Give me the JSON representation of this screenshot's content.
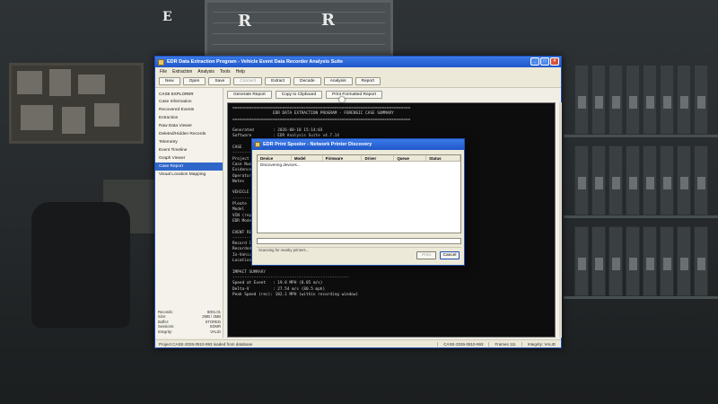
{
  "hud": {
    "letters": [
      "E",
      "R",
      "R"
    ]
  },
  "window": {
    "title": "EDR Data Extraction Program - Vehicle Event Data Recorder Analysis Suite",
    "menu": [
      "File",
      "Extraction",
      "Analysis",
      "Tools",
      "Help"
    ],
    "toolbar": [
      {
        "label": "New",
        "enabled": true
      },
      {
        "label": "Open",
        "enabled": true
      },
      {
        "label": "Save",
        "enabled": true
      },
      {
        "label": "Connect",
        "enabled": false
      },
      {
        "label": "Extract",
        "enabled": true
      },
      {
        "label": "Decode",
        "enabled": true
      },
      {
        "label": "Analysis",
        "enabled": true
      },
      {
        "label": "Report",
        "enabled": true
      }
    ]
  },
  "sidebar": {
    "heading": "CASE EXPLORER",
    "items": [
      "Case Information",
      "Recovered Events",
      "Extraction",
      "Raw Data Viewer",
      "Deleted/Hidden Records",
      "Telemetry",
      "Event Timeline",
      "Graph Viewer",
      "Case Report",
      "Visual Location Mapping"
    ],
    "active_index": 8,
    "stats": [
      {
        "k": "Records:",
        "v": "8001.01"
      },
      {
        "k": "Size:",
        "v": "2MB / 3MB"
      },
      {
        "k": "Buffer:",
        "v": "STORED"
      },
      {
        "k": "Sessions:",
        "v": "SDMR"
      },
      {
        "k": "Integrity:",
        "v": "VALID"
      }
    ]
  },
  "content": {
    "buttons": [
      "Generate Report",
      "Copy to Clipboard",
      "Print Formatted Report"
    ],
    "terminal": [
      "===========================================================================",
      "                 EDR DATA EXTRACTION PROGRAM - FORENSIC CASE SUMMARY",
      "===========================================================================",
      "",
      "Generated        : 2026-08-18 15:14:03",
      "Software         : EDR Analysis Suite v4.7.14",
      "",
      "CASE",
      "-------------------------------------------------",
      "Project I",
      "Case Numb",
      "Evidence",
      "Operator",
      "Notes",
      "",
      "VEHICLE ---",
      "-----------",
      "Pleate",
      "Model",
      "VIN (repo",
      "EDR Model",
      "",
      "EVENT REC",
      "-----------",
      "Record ID",
      "Recorded",
      "In-Vehicl",
      "Location",
      "",
      "IMPACT SUMMARY",
      "-------------------------------------------------",
      "Speed at Event   : 19.8 MPH (8.85 m/s)",
      "Delta-V          : 27.54 m/s (80.5 mph)",
      "Peak Speed (rec): 102.1 MPH (within recording window)"
    ]
  },
  "statusbar": {
    "left": "Project CASE-2026-0810-993 loaded from database",
    "right": [
      "CASE-2026-0810-993",
      "Frames 111",
      "Integrity: VALID"
    ]
  },
  "dialog": {
    "title": "EDR Print Spooler - Network Printer Discovery",
    "columns": [
      "Device",
      "Model",
      "Firmware",
      "Driver",
      "Queue",
      "Status"
    ],
    "rows": [
      "Discovering devices..."
    ],
    "message": "Scanning for nearby printers...",
    "print_label": "Print",
    "cancel_label": "Cancel"
  }
}
